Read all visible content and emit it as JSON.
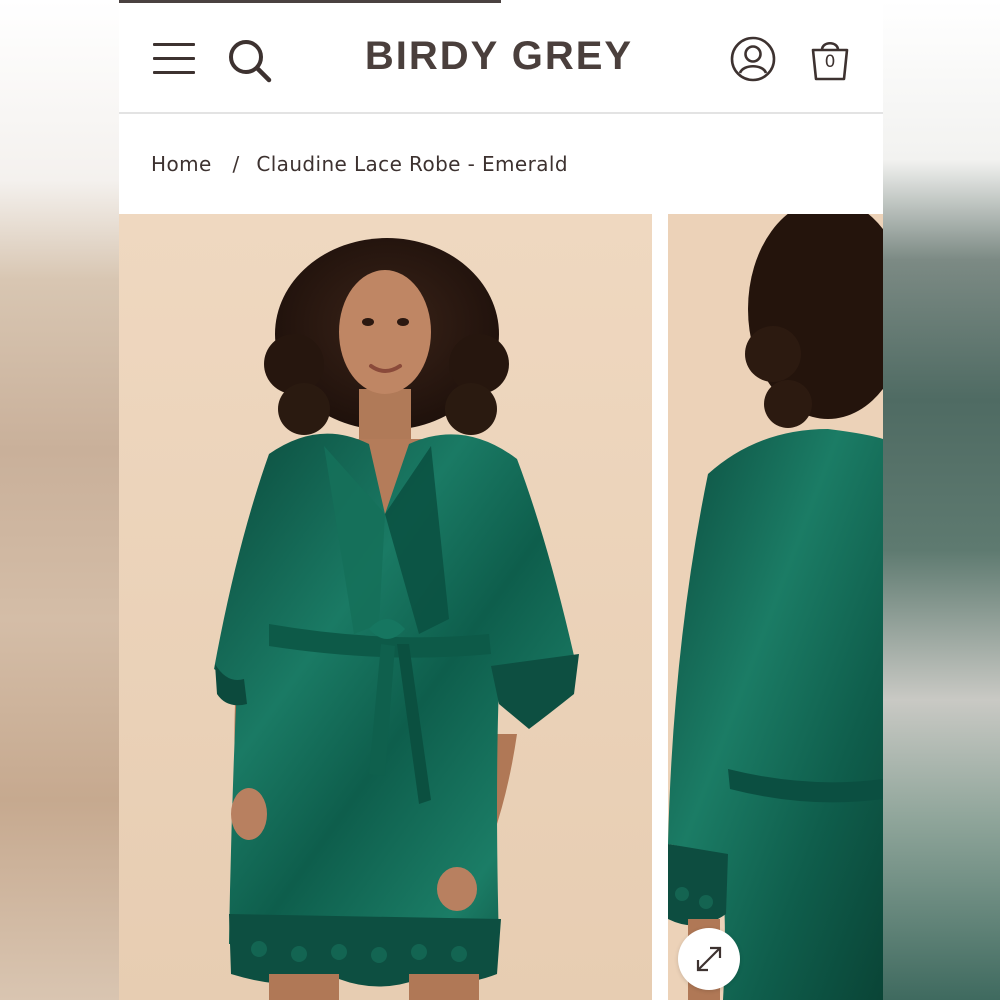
{
  "header": {
    "logo": "BIRDY GREY",
    "menu_icon": "hamburger-menu-icon",
    "search_icon": "search-icon",
    "account_icon": "account-icon",
    "cart_icon": "shopping-bag-icon",
    "cart_count": "0"
  },
  "breadcrumb": {
    "home": "Home",
    "separator": "/",
    "current": "Claudine Lace Robe - Emerald"
  },
  "gallery": {
    "images": [
      {
        "alt": "front-view",
        "color": "#0f5a4a"
      },
      {
        "alt": "back-view",
        "color": "#0f5a4a"
      }
    ],
    "expand_icon": "expand-icon"
  },
  "colors": {
    "brand_text": "#4a3f3c",
    "background_photo": "#ecd3ba",
    "robe_emerald": "#0f5a4a"
  }
}
